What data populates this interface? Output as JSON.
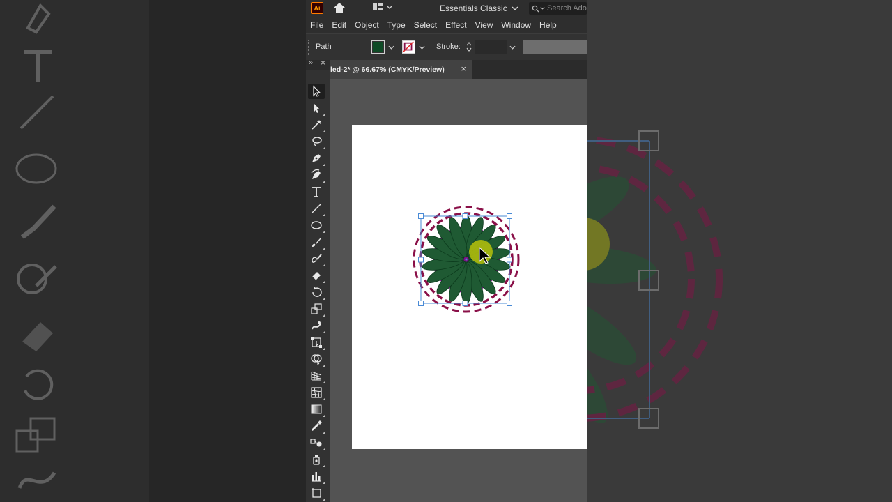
{
  "app": {
    "logo": "Ai",
    "workspace": "Essentials Classic",
    "search_placeholder": "Search Ado"
  },
  "menu": [
    "File",
    "Edit",
    "Object",
    "Type",
    "Select",
    "Effect",
    "View",
    "Window",
    "Help"
  ],
  "control_bar": {
    "selection_type": "Path",
    "fill_color": "#0e4a25",
    "stroke_label": "Stroke:"
  },
  "document": {
    "tab_title": "led-2* @ 66.67% (CMYK/Preview)",
    "close_glyph": "×"
  },
  "toolbar": {
    "collapse_glyph": "»",
    "close_glyph": "×",
    "tools": [
      "selection-tool",
      "direct-selection-tool",
      "magic-wand-tool",
      "lasso-tool",
      "pen-tool",
      "curvature-tool",
      "type-tool",
      "line-segment-tool",
      "ellipse-tool",
      "paintbrush-tool",
      "shaper-tool",
      "eraser-tool",
      "rotate-tool",
      "scale-tool",
      "warp-tool",
      "free-transform-tool",
      "shape-builder-tool",
      "perspective-grid-tool",
      "mesh-tool",
      "gradient-tool",
      "eyedropper-tool",
      "blend-tool",
      "symbol-sprayer-tool",
      "column-graph-tool",
      "artboard-tool"
    ]
  },
  "artwork": {
    "petal_color": "#1f5a33",
    "center_color": "#7d0f86",
    "ring_color": "#8a1048",
    "bbox_color": "#4a8bd6",
    "cursor_highlight": "#b7c20a"
  }
}
